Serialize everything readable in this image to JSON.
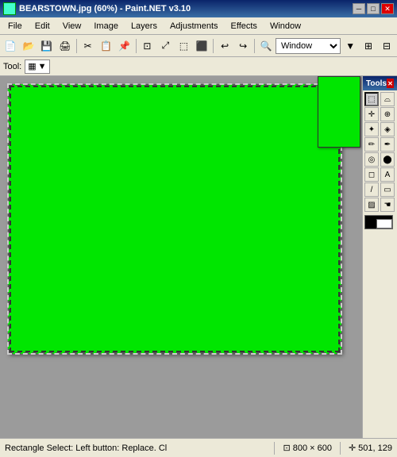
{
  "titlebar": {
    "title": "BEARSTOWN.jpg (60%) - Paint.NET v3.10",
    "min_btn": "─",
    "max_btn": "□",
    "close_btn": "✕"
  },
  "menu": {
    "items": [
      "File",
      "Edit",
      "View",
      "Image",
      "Layers",
      "Adjustments",
      "Effects",
      "Window"
    ]
  },
  "toolbar": {
    "window_label": "Window",
    "window_placeholder": "Window"
  },
  "tool_row": {
    "label": "Tool:",
    "selector_text": "▦ ▼"
  },
  "tools_panel": {
    "title": "Tools",
    "tools": [
      {
        "name": "rectangle-select",
        "icon": "⬚"
      },
      {
        "name": "lasso-select",
        "icon": "⌓"
      },
      {
        "name": "move-selected",
        "icon": "✛"
      },
      {
        "name": "zoom",
        "icon": "🔍"
      },
      {
        "name": "magic-wand",
        "icon": "✦"
      },
      {
        "name": "paint-bucket",
        "icon": "🪣"
      },
      {
        "name": "paintbrush",
        "icon": "✏"
      },
      {
        "name": "pencil",
        "icon": "✒"
      },
      {
        "name": "clone-stamp",
        "icon": "◎"
      },
      {
        "name": "recolor",
        "icon": "⬤"
      },
      {
        "name": "eraser",
        "icon": "◻"
      },
      {
        "name": "text",
        "icon": "A"
      },
      {
        "name": "line",
        "icon": "/"
      },
      {
        "name": "shapes",
        "icon": "▭"
      },
      {
        "name": "gradient",
        "icon": "▨"
      },
      {
        "name": "hand",
        "icon": "☚"
      }
    ]
  },
  "status": {
    "text": "Rectangle Select: Left button: Replace. Cl",
    "cursor_icon": "cursor",
    "dimensions": "800 × 600",
    "position": "501, 129"
  },
  "canvas": {
    "bg_color": "#00e600"
  }
}
